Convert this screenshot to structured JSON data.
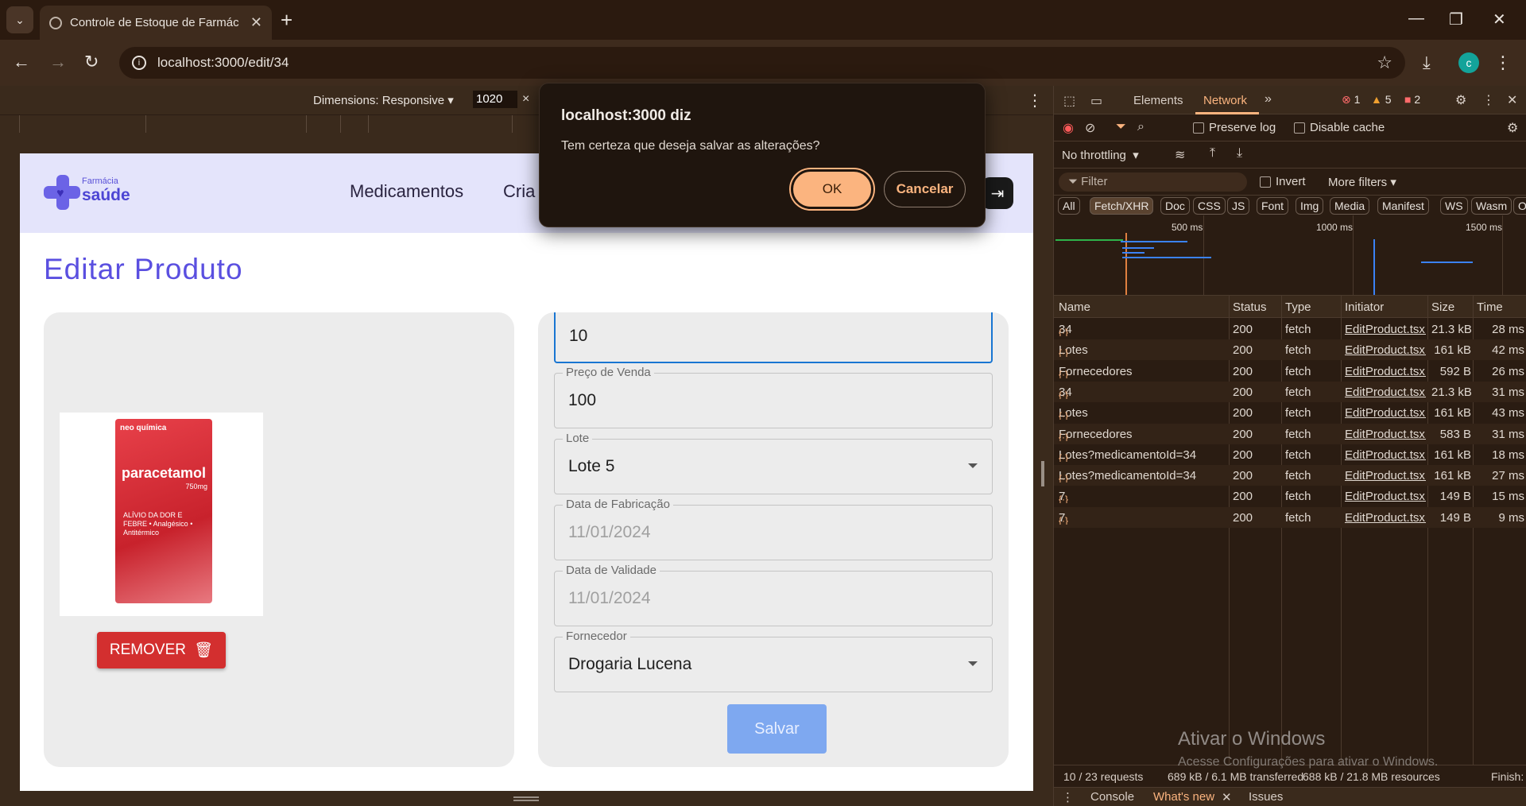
{
  "browser": {
    "tab_title": "Controle de Estoque de Farmác",
    "url": "localhost:3000/edit/34",
    "profile_initial": "c"
  },
  "device_toolbar": {
    "dimensions_label": "Dimensions: Responsive",
    "width_value": "1020"
  },
  "site": {
    "logo_small": "Farmácia",
    "logo_big": "saúde",
    "nav": [
      "Medicamentos",
      "Cria"
    ],
    "page_title": "Editar Produto",
    "product_box": {
      "brand": "neo química",
      "name": "paracetamol",
      "dose": "750mg",
      "sub": "ALÍVIO DA DOR E FEBRE • Analgésico • Antitérmico"
    },
    "remove_label": "REMOVER",
    "fields": {
      "top_value": "10",
      "sale_price_label": "Preço de Venda",
      "sale_price_value": "100",
      "lot_label": "Lote",
      "lot_value": "Lote 5",
      "mfg_label": "Data de Fabricação",
      "mfg_value": "11/01/2024",
      "exp_label": "Data de Validade",
      "exp_value": "11/01/2024",
      "supplier_label": "Fornecedor",
      "supplier_value": "Drogaria Lucena"
    },
    "save_label": "Salvar"
  },
  "dialog": {
    "title": "localhost:3000 diz",
    "message": "Tem certeza que deseja salvar as alterações?",
    "ok_label": "OK",
    "cancel_label": "Cancelar"
  },
  "devtools": {
    "tabs": [
      "Elements",
      "Network"
    ],
    "errors": "1",
    "warnings": "5",
    "issues": "2",
    "preserve_log": "Preserve log",
    "disable_cache": "Disable cache",
    "throttling": "No throttling",
    "filter_placeholder": "Filter",
    "invert": "Invert",
    "more_filters": "More filters",
    "type_filters": [
      "All",
      "Fetch/XHR",
      "Doc",
      "CSS",
      "JS",
      "Font",
      "Img",
      "Media",
      "Manifest",
      "WS",
      "Wasm",
      "O"
    ],
    "timeline_labels": [
      "500 ms",
      "1000 ms",
      "1500 ms"
    ],
    "columns": [
      "Name",
      "Status",
      "Type",
      "Initiator",
      "Size",
      "Time"
    ],
    "requests": [
      {
        "name": "34",
        "status": "200",
        "type": "fetch",
        "initiator": "EditProduct.tsx:",
        "size": "21.3 kB",
        "time": "28 ms"
      },
      {
        "name": "Lotes",
        "status": "200",
        "type": "fetch",
        "initiator": "EditProduct.tsx:",
        "size": "161 kB",
        "time": "42 ms"
      },
      {
        "name": "Fornecedores",
        "status": "200",
        "type": "fetch",
        "initiator": "EditProduct.tsx:",
        "size": "592 B",
        "time": "26 ms"
      },
      {
        "name": "34",
        "status": "200",
        "type": "fetch",
        "initiator": "EditProduct.tsx:",
        "size": "21.3 kB",
        "time": "31 ms"
      },
      {
        "name": "Lotes",
        "status": "200",
        "type": "fetch",
        "initiator": "EditProduct.tsx:",
        "size": "161 kB",
        "time": "43 ms"
      },
      {
        "name": "Fornecedores",
        "status": "200",
        "type": "fetch",
        "initiator": "EditProduct.tsx:",
        "size": "583 B",
        "time": "31 ms"
      },
      {
        "name": "Lotes?medicamentoId=34",
        "status": "200",
        "type": "fetch",
        "initiator": "EditProduct.tsx:",
        "size": "161 kB",
        "time": "18 ms"
      },
      {
        "name": "Lotes?medicamentoId=34",
        "status": "200",
        "type": "fetch",
        "initiator": "EditProduct.tsx:",
        "size": "161 kB",
        "time": "27 ms"
      },
      {
        "name": "7",
        "status": "200",
        "type": "fetch",
        "initiator": "EditProduct.tsx:",
        "size": "149 B",
        "time": "15 ms"
      },
      {
        "name": "7",
        "status": "200",
        "type": "fetch",
        "initiator": "EditProduct.tsx:",
        "size": "149 B",
        "time": "9 ms"
      }
    ],
    "status_requests": "10 / 23 requests",
    "status_transferred": "689 kB / 6.1 MB transferred",
    "status_resources": "688 kB / 21.8 MB resources",
    "status_finish": "Finish:",
    "drawer_tabs": [
      "Console",
      "What's new",
      "Issues"
    ]
  },
  "watermark": {
    "title": "Ativar o Windows",
    "subtitle": "Acesse Configurações para ativar o Windows."
  }
}
